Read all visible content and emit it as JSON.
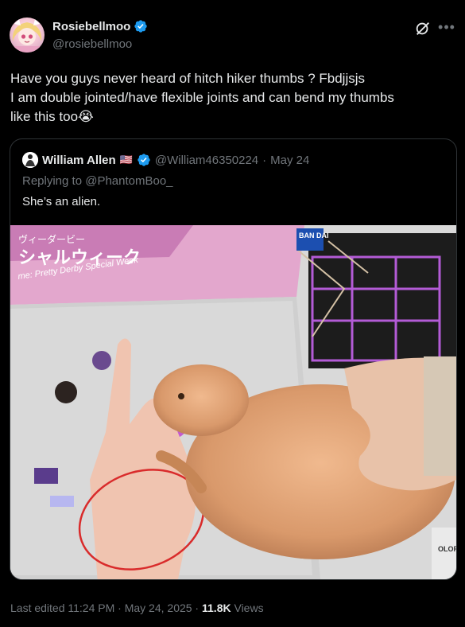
{
  "author": {
    "display_name": "Rosiebellmoo",
    "handle": "@rosiebellmoo",
    "verified_color": "#1d9bf0"
  },
  "tweet": {
    "lines": [
      "Have you guys never heard of hitch hiker thumbs ? Fbdjjsjs",
      "I am double jointed/have flexible joints and can bend my thumbs",
      "like this too😭"
    ]
  },
  "quoted_tweet": {
    "display_name": "William Allen",
    "flag": "🇺🇸",
    "handle": "@William46350224",
    "separator": "·",
    "date": "May 24",
    "replying_to": "Replying to @PhantomBoo_",
    "text": "She’s an alien.",
    "image_text": {
      "box_title": "ヴィーダービー",
      "box_name": "シャルウィーク",
      "box_subtitle": "me: Pretty Derby Special Week",
      "brand": "BAN DAI",
      "side_text": "OLOR IDE"
    }
  },
  "footer": {
    "edited": "Last edited 11:24 PM · May 24, 2025 · ",
    "views_count": "11.8K",
    "views_label": " Views"
  },
  "icons": [
    "verified-badge-icon",
    "grok-icon",
    "more-icon"
  ]
}
